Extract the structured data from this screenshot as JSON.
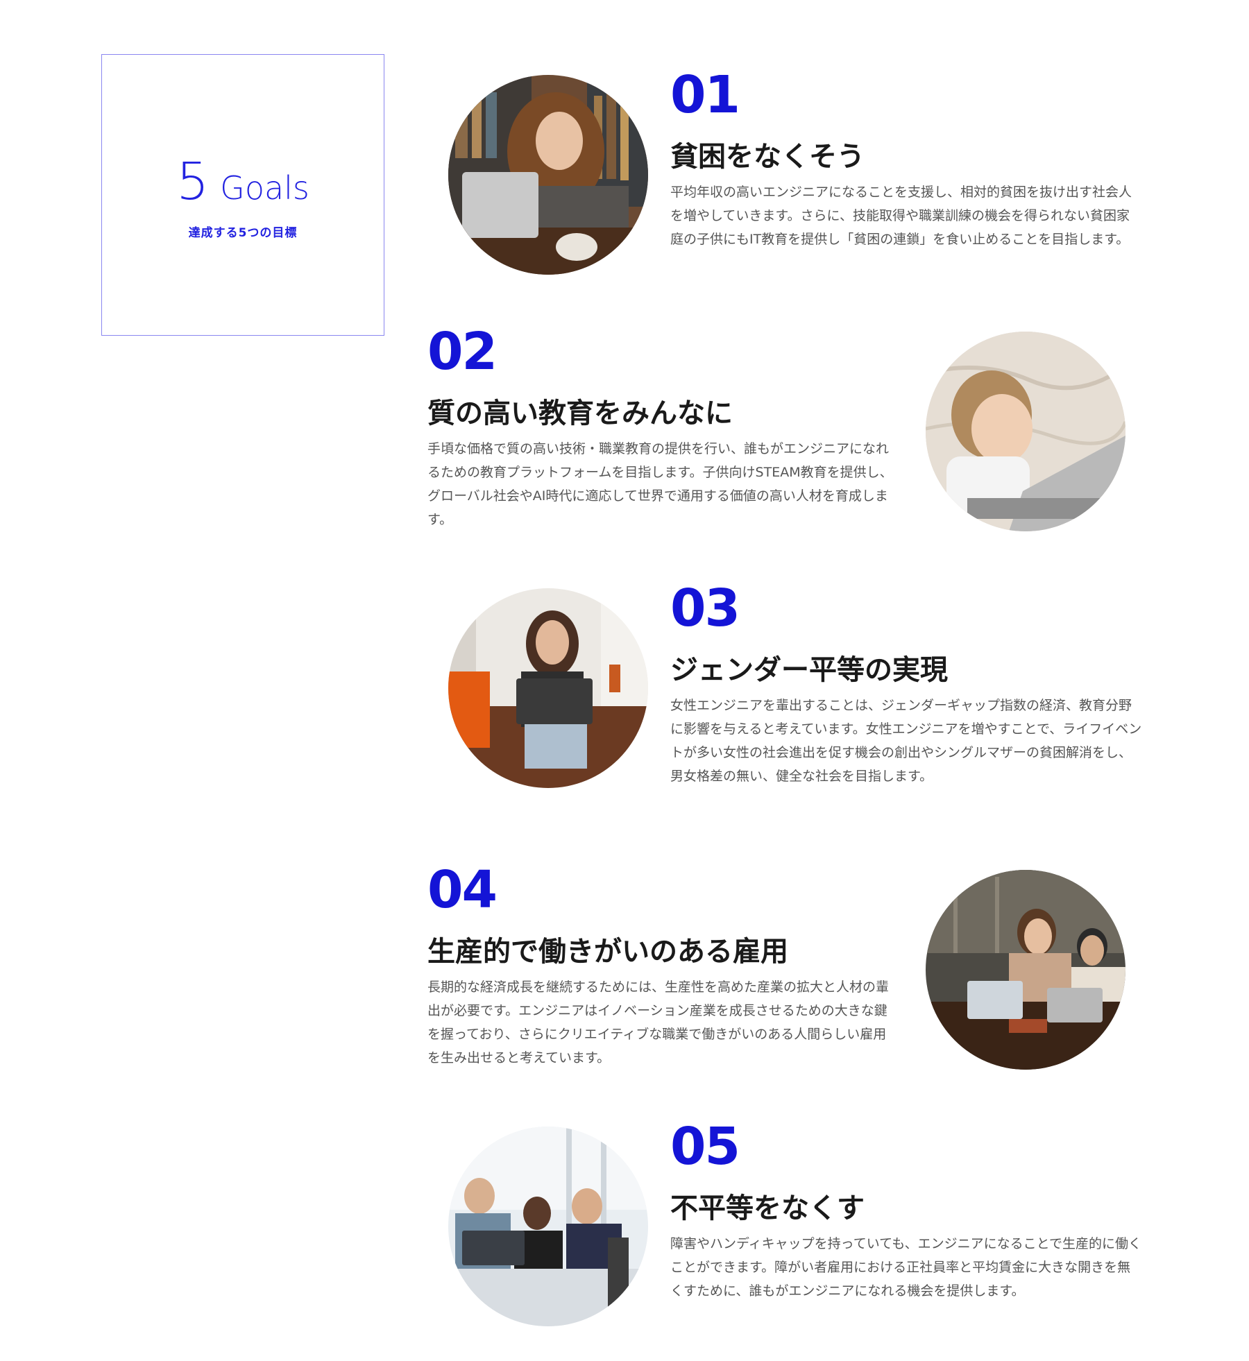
{
  "intro": {
    "number": "5",
    "word": "Goals",
    "subtitle": "達成する5つの目標"
  },
  "goals": [
    {
      "number": "01",
      "title": "貧困をなくそう",
      "body": "平均年収の高いエンジニアになることを支援し、相対的貧困を抜け出す社会人を増やしていきます。さらに、技能取得や職業訓練の機会を得られない貧困家庭の子供にもIT教育を提供し「貧困の連鎖」を食い止めることを目指します。"
    },
    {
      "number": "02",
      "title": "質の高い教育をみんなに",
      "body": "手頃な価格で質の高い技術・職業教育の提供を行い、誰もがエンジニアになれるための教育プラットフォームを目指します。子供向けSTEAM教育を提供し、グローバル社会やAI時代に適応して世界で通用する価値の高い人材を育成します。"
    },
    {
      "number": "03",
      "title": "ジェンダー平等の実現",
      "body": "女性エンジニアを輩出することは、ジェンダーギャップ指数の経済、教育分野に影響を与えると考えています。女性エンジニアを増やすことで、ライフイベントが多い女性の社会進出を促す機会の創出やシングルマザーの貧困解消をし、男女格差の無い、健全な社会を目指します。"
    },
    {
      "number": "04",
      "title": "生産的で働きがいのある雇用",
      "body": "長期的な経済成長を継続するためには、生産性を高めた産業の拡大と人材の輩出が必要です。エンジニアはイノベーション産業を成長させるための大きな鍵を握っており、さらにクリエイティブな職業で働きがいのある人間らしい雇用を生み出せると考えています。"
    },
    {
      "number": "05",
      "title": "不平等をなくす",
      "body": "障害やハンディキャップを持っていても、エンジニアになることで生産的に働くことができます。障がい者雇用における正社員率と平均賃金に大きな開きを無くすために、誰もがエンジニアになれる機会を提供します。"
    }
  ],
  "colors": {
    "accent": "#1414d6",
    "intro_accent": "#2222e0",
    "intro_border": "#8a86f0",
    "body_text": "#555555",
    "title_text": "#1a1a1a"
  }
}
